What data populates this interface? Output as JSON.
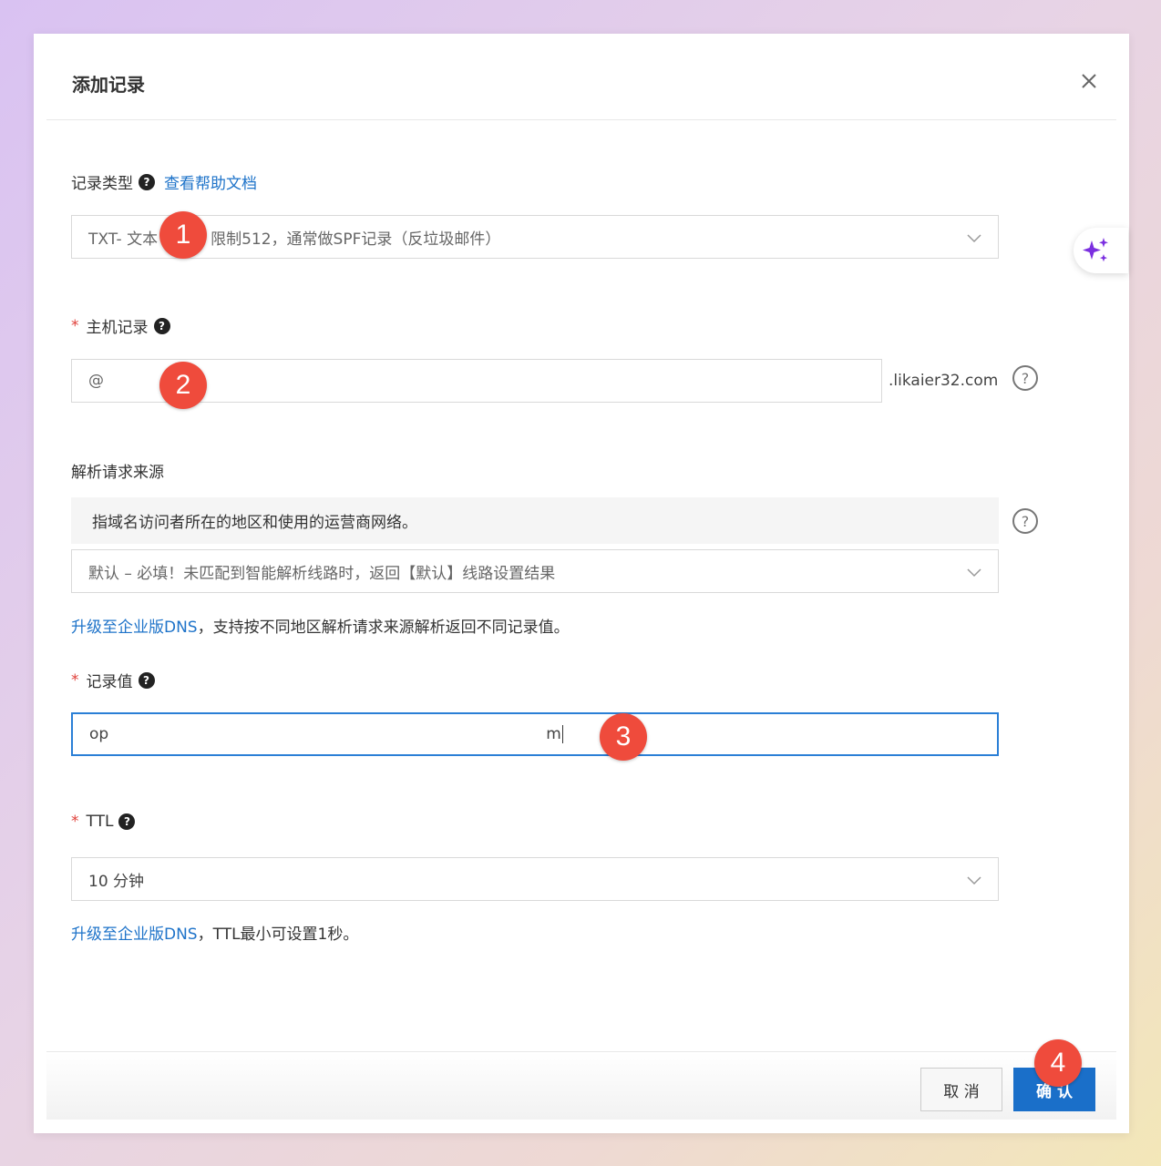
{
  "dialog": {
    "title": "添加记录"
  },
  "record_type": {
    "label": "记录类型",
    "help_link": "查看帮助文档",
    "value": "TXT- 文本",
    "value_rest": "限制512，通常做SPF记录（反垃圾邮件）"
  },
  "host_record": {
    "required_mark": "*",
    "label": "主机记录",
    "value": "@",
    "suffix": ".likaier32.com"
  },
  "resolve_source": {
    "label": "解析请求来源",
    "hint": "指域名访问者所在的地区和使用的运营商网络。",
    "value": "默认 – 必填！未匹配到智能解析线路时，返回【默认】线路设置结果",
    "upgrade_link": "升级至企业版DNS",
    "upgrade_text": "，支持按不同地区解析请求来源解析返回不同记录值。"
  },
  "record_value": {
    "required_mark": "*",
    "label": "记录值",
    "value_start": "op",
    "value_end": "m"
  },
  "ttl": {
    "required_mark": "*",
    "label": "TTL",
    "value": "10 分钟",
    "upgrade_link": "升级至企业版DNS",
    "upgrade_text": "，TTL最小可设置1秒。"
  },
  "footer": {
    "cancel_label": "取 消",
    "ok_label": "确 认"
  },
  "badges": [
    "1",
    "2",
    "3",
    "4"
  ],
  "icons": {
    "close": "close-icon",
    "help": "question-icon",
    "dropdown": "chevron-down-icon",
    "ai": "sparkle-icon"
  },
  "colors": {
    "link": "#1e73c9",
    "primary_button": "#1a6fc9",
    "badge": "#ef4b3c",
    "required": "#e0403a",
    "focus_border": "#2a7fd6",
    "ai_sparkle": "#7b2fe0"
  }
}
